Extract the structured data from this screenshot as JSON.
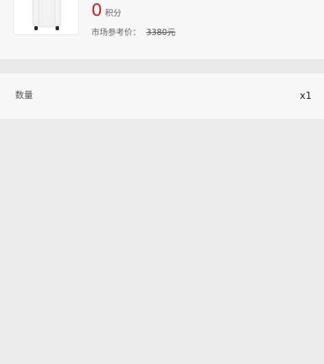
{
  "product": {
    "image_icon": "suitcase-icon",
    "points_value": "0",
    "points_unit": "积分",
    "market_label": "市场参考价：",
    "market_price": "3380元"
  },
  "order": {
    "quantity_label": "数量",
    "quantity_value": "x1"
  },
  "colors": {
    "accent_red": "#c8202b",
    "background": "#ebebed",
    "card": "#f7f7f7"
  }
}
